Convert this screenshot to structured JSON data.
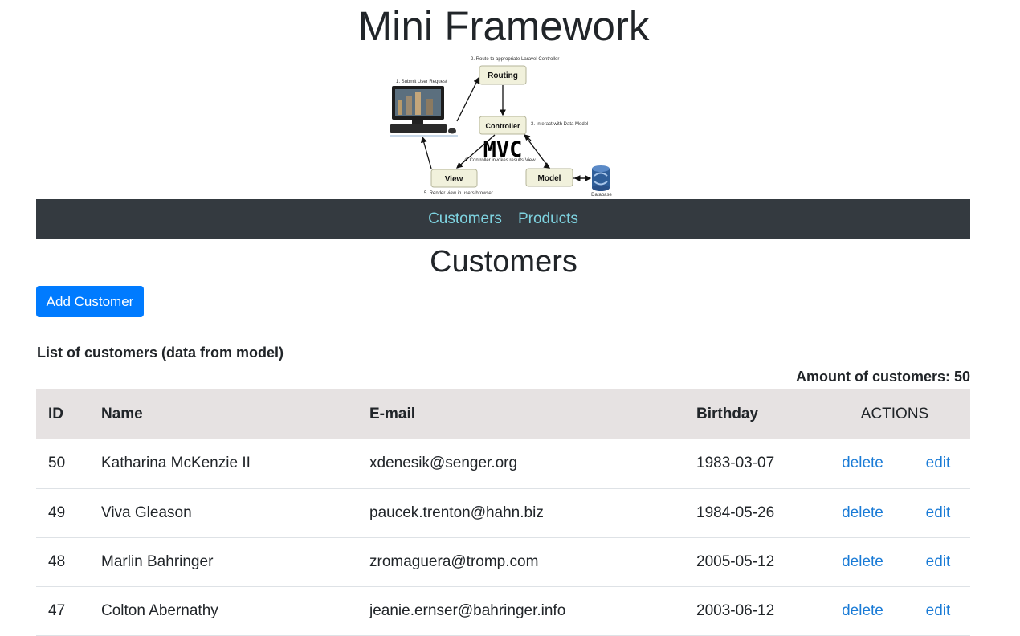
{
  "site": {
    "title": "Mini Framework"
  },
  "banner": {
    "labels": {
      "step1": "1. Submit User Request",
      "step2": "2. Route to appropriate Laravel Controller",
      "step3": "3. Interact with Data Model",
      "step4": "4. Controller invokes results View",
      "step5": "5. Render view in users browser",
      "routing": "Routing",
      "controller": "Controller",
      "view": "View",
      "model": "Model",
      "mvc": "MVC",
      "database": "Database"
    }
  },
  "nav": {
    "items": [
      {
        "label": "Customers"
      },
      {
        "label": "Products"
      }
    ]
  },
  "page": {
    "heading": "Customers",
    "add_button": "Add Customer",
    "list_caption": "List of customers (data from model)",
    "amount_label": "Amount of customers: 50"
  },
  "table": {
    "headers": {
      "id": "ID",
      "name": "Name",
      "email": "E-mail",
      "birthday": "Birthday",
      "actions": "ACTIONS"
    },
    "rows": [
      {
        "id": "50",
        "name": "Katharina McKenzie II",
        "email": "xdenesik@senger.org",
        "birthday": "1983-03-07",
        "delete": "delete",
        "edit": "edit"
      },
      {
        "id": "49",
        "name": "Viva Gleason",
        "email": "paucek.trenton@hahn.biz",
        "birthday": "1984-05-26",
        "delete": "delete",
        "edit": "edit"
      },
      {
        "id": "48",
        "name": "Marlin Bahringer",
        "email": "zromaguera@tromp.com",
        "birthday": "2005-05-12",
        "delete": "delete",
        "edit": "edit"
      },
      {
        "id": "47",
        "name": "Colton Abernathy",
        "email": "jeanie.ernser@bahringer.info",
        "birthday": "2003-06-12",
        "delete": "delete",
        "edit": "edit"
      }
    ]
  },
  "colors": {
    "navbar": "#343a40",
    "nav_link": "#7ed3e0",
    "primary_button": "#007bff",
    "table_header": "#e6e2e2",
    "action_link": "#1a7bd6"
  }
}
